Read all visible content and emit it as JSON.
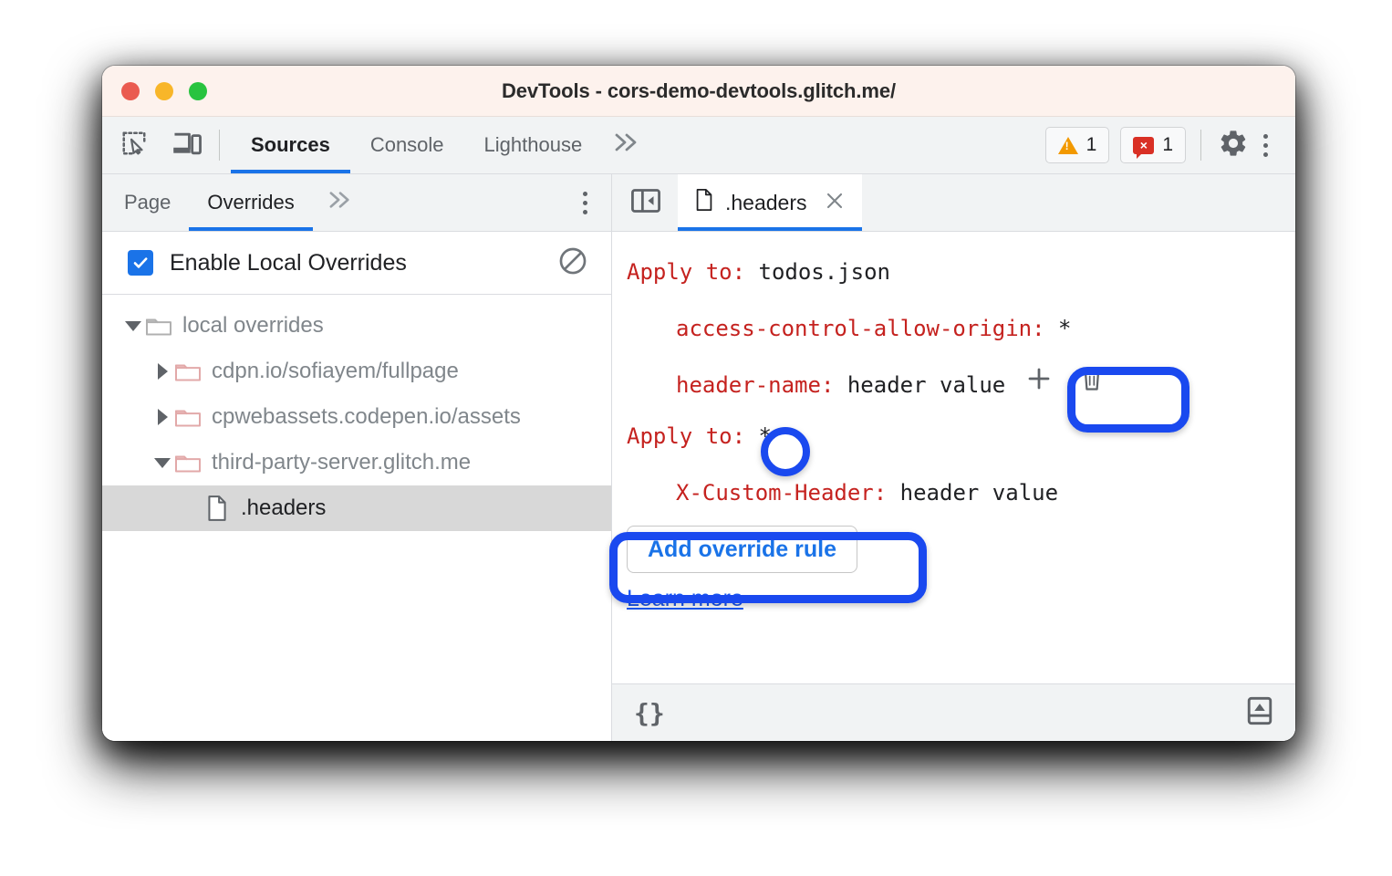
{
  "window": {
    "title": "DevTools - cors-demo-devtools.glitch.me/",
    "traffic_lights": [
      "close-red",
      "minimize-yellow",
      "zoom-green"
    ]
  },
  "toolbar": {
    "inspect_icon": "inspect-element-icon",
    "device_icon": "device-toolbar-icon",
    "tabs": [
      {
        "label": "Sources",
        "active": true
      },
      {
        "label": "Console",
        "active": false
      },
      {
        "label": "Lighthouse",
        "active": false
      }
    ],
    "more_tabs_icon": "chevron-double-right-icon",
    "more_tabs_label": "»",
    "warnings": {
      "icon": "warning-triangle-icon",
      "count": "1"
    },
    "errors": {
      "icon": "error-bubble-icon",
      "count": "1",
      "glyph": "×"
    },
    "settings_icon": "gear-icon",
    "menu_icon": "kebab-menu-icon"
  },
  "navigator": {
    "tabs": [
      {
        "label": "Page",
        "active": false
      },
      {
        "label": "Overrides",
        "active": true
      }
    ],
    "more_tabs_label": "»",
    "menu_icon": "kebab-menu-icon",
    "enable_overrides": {
      "label": "Enable Local Overrides",
      "checked": true,
      "clear_icon": "clear-overrides-icon"
    },
    "tree": [
      {
        "label": "local overrides",
        "type": "folder",
        "expanded": true,
        "depth": 0,
        "selected": false,
        "folder_color": "gray"
      },
      {
        "label": "cdpn.io/sofiayem/fullpage",
        "type": "folder",
        "expanded": false,
        "depth": 1,
        "selected": false,
        "folder_color": "pink"
      },
      {
        "label": "cpwebassets.codepen.io/assets",
        "type": "folder",
        "expanded": false,
        "depth": 1,
        "selected": false,
        "folder_color": "pink"
      },
      {
        "label": "third-party-server.glitch.me",
        "type": "folder",
        "expanded": true,
        "depth": 1,
        "selected": false,
        "folder_color": "pink"
      },
      {
        "label": ".headers",
        "type": "file",
        "expanded": null,
        "depth": 2,
        "selected": true,
        "folder_color": null
      }
    ]
  },
  "editor": {
    "panel_toggle_icon": "show-navigator-panel-icon",
    "tab": {
      "file_icon": "file-icon",
      "label": ".headers",
      "close_icon": "close-icon",
      "active": true
    },
    "header_rules": [
      {
        "apply_to_label": "Apply to",
        "apply_to_value": "todos.json",
        "headers": [
          {
            "name": "access-control-allow-origin",
            "value": "*",
            "has_actions": false
          },
          {
            "name": "header-name",
            "value": "header value",
            "has_actions": true,
            "add_icon": "plus-icon",
            "delete_icon": "trash-icon"
          }
        ]
      },
      {
        "apply_to_label": "Apply to",
        "apply_to_value": "*",
        "headers": [
          {
            "name": "X-Custom-Header",
            "value": "header value",
            "has_actions": false
          }
        ]
      }
    ],
    "add_override_rule_label": "Add override rule",
    "learn_more_label": "Learn more"
  },
  "statusbar": {
    "format_label": "{}",
    "format_icon": "pretty-print-icon",
    "drawer_icon": "show-drawer-icon"
  },
  "annotations": {
    "color": "#1a49ef",
    "targets": [
      "row-actions-plus-trash",
      "apply-to-wildcard-value",
      "add-override-rule-button"
    ]
  },
  "colors": {
    "accent_blue": "#1a73e8",
    "annotation_blue": "#1a49ef",
    "header_key_red": "#c5221f",
    "warning_orange": "#f29900",
    "error_red": "#d93025",
    "titlebar_bg": "#fdf2ed",
    "toolbar_bg": "#f1f3f4",
    "selected_row_bg": "#d8d8d8"
  }
}
